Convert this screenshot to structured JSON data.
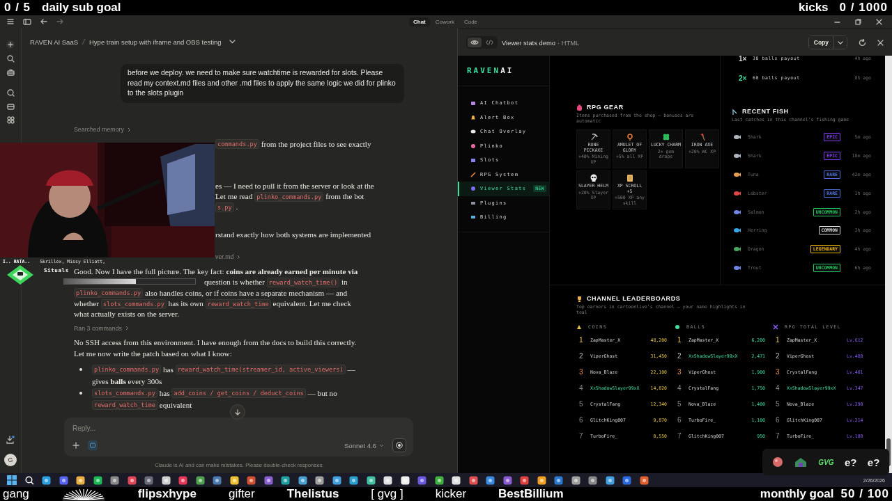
{
  "stream_overlay": {
    "sub_count": "0 / 5",
    "sub_label": "daily sub goal",
    "kicks_label": "kicks",
    "kicks_count": "0 / 1000",
    "ticker": [
      {
        "kind": "text",
        "text": "gang"
      },
      {
        "kind": "logo"
      },
      {
        "kind": "display",
        "text": "flipsxhype"
      },
      {
        "kind": "text",
        "text": "gifter"
      },
      {
        "kind": "display",
        "text": "Thelistus"
      },
      {
        "kind": "text",
        "text": "[ gvg ]"
      },
      {
        "kind": "text",
        "text": "kicker"
      },
      {
        "kind": "display",
        "text": "BestBillium"
      }
    ],
    "monthly_label": "monthly goal",
    "monthly_count": "50 / 100"
  },
  "now_playing": {
    "title": "I.. RATA..",
    "artists": "Skrillex, Missy Elliott,",
    "label": "Situals",
    "level": 0.55
  },
  "app": {
    "tabs": [
      {
        "label": "Chat",
        "selected": true
      },
      {
        "label": "Cowork",
        "selected": false
      },
      {
        "label": "Code",
        "selected": false
      }
    ],
    "breadcrumb": {
      "project": "RAVEN AI SaaS",
      "chat": "Hype train setup with iframe and OBS testing"
    },
    "user_message": "before we deploy. we need to make sure watchtime is rewarded for slots. Please read my context.md files and other .md files to apply the same logic we did for plinko to the slots plugin",
    "blocks": [
      {
        "kind": "step",
        "text": "Searched memory"
      },
      {
        "kind": "camera-para",
        "lines": [
          [
            {
              "kind": "code",
              "text": "commands.py"
            },
            {
              "kind": "text",
              "text": " from the project files to see exactly"
            }
          ]
        ]
      },
      {
        "kind": "camera-para",
        "lines": [
          [
            {
              "kind": "text",
              "text": "es — I need to pull it from the server or look at the"
            }
          ],
          [
            {
              "kind": "text",
              "text": "Let me read "
            },
            {
              "kind": "code",
              "text": "plinko_commands.py"
            },
            {
              "kind": "text",
              "text": " from the bot"
            }
          ],
          [
            {
              "kind": "code",
              "text": "s.py"
            },
            {
              "kind": "text",
              "text": " ."
            }
          ]
        ]
      },
      {
        "kind": "camera-para",
        "lines": [
          [
            {
              "kind": "text",
              "text": "rstand exactly how both systems are implemented"
            }
          ]
        ]
      },
      {
        "kind": "camera-step",
        "text": "ver.md"
      },
      {
        "kind": "para",
        "lines": [
          {
            "kind": "full",
            "segments": [
              {
                "kind": "text",
                "text": "Good. Now I have the full picture. The key fact: **coins are already earned per minute via**"
              }
            ]
          },
          {
            "kind": "partial",
            "segments": [
              {
                "kind": "text",
                "text": "question is whether "
              },
              {
                "kind": "code",
                "text": "reward_watch_time()"
              },
              {
                "kind": "text",
                "text": " in"
              }
            ]
          },
          {
            "kind": "full",
            "segments": [
              {
                "kind": "code",
                "text": "plinko_commands.py"
              },
              {
                "kind": "text",
                "text": " also handles coins, or if coins have a separate mechanism — and"
              }
            ]
          },
          {
            "kind": "full",
            "segments": [
              {
                "kind": "text",
                "text": "whether "
              },
              {
                "kind": "code",
                "text": "slots_commands.py"
              },
              {
                "kind": "text",
                "text": " has its own "
              },
              {
                "kind": "code",
                "text": "reward_watch_time"
              },
              {
                "kind": "text",
                "text": " equivalent. Let me check"
              }
            ]
          },
          {
            "kind": "full",
            "segments": [
              {
                "kind": "text",
                "text": "what actually exists on the server."
              }
            ]
          }
        ]
      },
      {
        "kind": "step",
        "text": "Ran 3 commands"
      },
      {
        "kind": "para",
        "lines": [
          {
            "kind": "full",
            "segments": [
              {
                "kind": "text",
                "text": "No SSH access from this environment. I have enough from the docs to build this correctly."
              }
            ]
          },
          {
            "kind": "full",
            "segments": [
              {
                "kind": "text",
                "text": "Let me now write the patch based on what I know:"
              }
            ]
          }
        ]
      },
      {
        "kind": "bullets",
        "items": [
          {
            "lines": [
              [
                {
                  "kind": "code",
                  "text": "plinko_commands.py"
                },
                {
                  "kind": "text",
                  "text": " has "
                },
                {
                  "kind": "code",
                  "text": "reward_watch_time(streamer_id, active_viewers)"
                },
                {
                  "kind": "text",
                  "text": " —"
                }
              ],
              [
                {
                  "kind": "text",
                  "text": "gives **balls** every 300s"
                }
              ]
            ]
          },
          {
            "lines": [
              [
                {
                  "kind": "code",
                  "text": "slots_commands.py"
                },
                {
                  "kind": "text",
                  "text": " has "
                },
                {
                  "kind": "code",
                  "text": "add_coins / get_coins / deduct_coins"
                },
                {
                  "kind": "text",
                  "text": " — but no"
                }
              ],
              [
                {
                  "kind": "code",
                  "text": "reward_watch_time"
                },
                {
                  "kind": "text",
                  "text": " equivalent"
                }
              ]
            ]
          }
        ]
      }
    ],
    "input": {
      "placeholder": "Reply...",
      "model": "Sonnet 4.6"
    },
    "disclaimer": "Claude is AI and can make mistakes. Please double-check responses.",
    "avatar": "G"
  },
  "artifact": {
    "view_modes": [
      {
        "kind": "preview",
        "selected": true
      },
      {
        "kind": "code",
        "selected": false
      }
    ],
    "title": "Viewer stats demo",
    "type": "· HTML",
    "copy": "Copy",
    "logo": {
      "main": "RAVEN",
      "accent": "AI"
    },
    "nav": [
      {
        "label": "AI Chatbot",
        "selected": false
      },
      {
        "label": "Alert Box",
        "selected": false
      },
      {
        "label": "Chat Overlay",
        "selected": false
      },
      {
        "label": "Plinko",
        "selected": false
      },
      {
        "label": "Slots",
        "selected": false
      },
      {
        "label": "RPG System",
        "selected": false
      },
      {
        "label": "Viewer Stats",
        "selected": true,
        "badge": "NEW"
      },
      {
        "label": "Plugins",
        "selected": false
      },
      {
        "label": "Billing",
        "selected": false
      }
    ],
    "payouts": [
      {
        "multiplier": "1×",
        "text": "30 balls payout",
        "time": "4h ago",
        "color": "#d9d9d9"
      },
      {
        "multiplier": "2×",
        "text": "60 balls payout",
        "time": "8h ago",
        "color": "#3ee0a0"
      }
    ],
    "gear": {
      "title": "RPG GEAR",
      "subtitle": "Items purchased from the shop — bonuses are automatic",
      "items": [
        {
          "name": "RUNE PICKAXE",
          "bonus": "+40% Mining XP"
        },
        {
          "name": "AMULET OF GLORY",
          "bonus": "+5% all XP"
        },
        {
          "name": "LUCKY CHARM",
          "bonus": "2× gem drops"
        },
        {
          "name": "IRON AXE",
          "bonus": "+20% WC XP"
        },
        {
          "name": "SLAYER HELM",
          "bonus": "+20% Slayer XP"
        },
        {
          "name": "XP SCROLL +5",
          "bonus": "+500 XP any skill"
        }
      ]
    },
    "fish": {
      "title": "RECENT FISH",
      "subtitle": "Last catches in this channel's fishing game",
      "rows": [
        {
          "name": "Shark",
          "rarity": "EPIC",
          "color": "#7c3aed",
          "time": "5m ago"
        },
        {
          "name": "Shark",
          "rarity": "EPIC",
          "color": "#7c3aed",
          "time": "18m ago"
        },
        {
          "name": "Tuna",
          "rarity": "RARE",
          "color": "#4f6fe0",
          "time": "42m ago"
        },
        {
          "name": "Lobster",
          "rarity": "RARE",
          "color": "#4f6fe0",
          "time": "1h ago"
        },
        {
          "name": "Salmon",
          "rarity": "UNCOMMON",
          "color": "#22c55e",
          "time": "2h ago"
        },
        {
          "name": "Herring",
          "rarity": "COMMON",
          "color": "#d4d4d4",
          "time": "3h ago"
        },
        {
          "name": "Dragon",
          "rarity": "LEGENDARY",
          "color": "#eab308",
          "time": "4h ago"
        },
        {
          "name": "Trout",
          "rarity": "UNCOMMON",
          "color": "#22c55e",
          "time": "6h ago"
        }
      ]
    },
    "leaderboards": {
      "title": "CHANNEL LEADERBOARDS",
      "subtitle": "Top earners in cartoonlive's channel — your name highlights in teal",
      "columns": [
        {
          "title": "COINS",
          "color": "#e8c547",
          "rows": [
            {
              "rank": "1",
              "name": "ZapMaster_X",
              "value": "48,200",
              "you": false
            },
            {
              "rank": "2",
              "name": "ViperGhost",
              "value": "31,450",
              "you": false
            },
            {
              "rank": "3",
              "name": "Nova_Blaze",
              "value": "22,100",
              "you": false
            },
            {
              "rank": "4",
              "name": "XxShadowSlayer99xX",
              "value": "14,820",
              "you": true
            },
            {
              "rank": "5",
              "name": "CrystalFang",
              "value": "12,340",
              "you": false
            },
            {
              "rank": "6",
              "name": "GlitchKing007",
              "value": "9,870",
              "you": false
            },
            {
              "rank": "7",
              "name": "TurboFire_",
              "value": "8,550",
              "you": false
            }
          ]
        },
        {
          "title": "BALLS",
          "color": "#3ee0a0",
          "rows": [
            {
              "rank": "1",
              "name": "ZapMaster_X",
              "value": "6,200",
              "you": false
            },
            {
              "rank": "2",
              "name": "XxShadowSlayer99xX",
              "value": "2,471",
              "you": true
            },
            {
              "rank": "3",
              "name": "ViperGhost",
              "value": "1,900",
              "you": false
            },
            {
              "rank": "4",
              "name": "CrystalFang",
              "value": "1,750",
              "you": false
            },
            {
              "rank": "5",
              "name": "Nova_Blaze",
              "value": "1,400",
              "you": false
            },
            {
              "rank": "6",
              "name": "TurboFire_",
              "value": "1,100",
              "you": false
            },
            {
              "rank": "7",
              "name": "GlitchKing007",
              "value": "950",
              "you": false
            }
          ]
        },
        {
          "title": "RPG TOTAL LEVEL",
          "color": "#8b5cf6",
          "rows": [
            {
              "rank": "1",
              "name": "ZapMaster_X",
              "value": "Lv.612",
              "you": false
            },
            {
              "rank": "2",
              "name": "ViperGhost",
              "value": "Lv.480",
              "you": false
            },
            {
              "rank": "3",
              "name": "CrystalFang",
              "value": "Lv.401",
              "you": false
            },
            {
              "rank": "4",
              "name": "XxShadowSlayer99xX",
              "value": "Lv.347",
              "you": true
            },
            {
              "rank": "5",
              "name": "Nova_Blaze",
              "value": "Lv.290",
              "you": false
            },
            {
              "rank": "6",
              "name": "GlitchKing007",
              "value": "Lv.214",
              "you": false
            },
            {
              "rank": "7",
              "name": "TurboFire_",
              "value": "Lv.188",
              "you": false
            }
          ]
        }
      ]
    }
  },
  "tray_overlay": {
    "badge": "GVG",
    "labels": [
      "e?",
      "e?"
    ]
  },
  "taskbar": {
    "date": "2/26/2026"
  }
}
